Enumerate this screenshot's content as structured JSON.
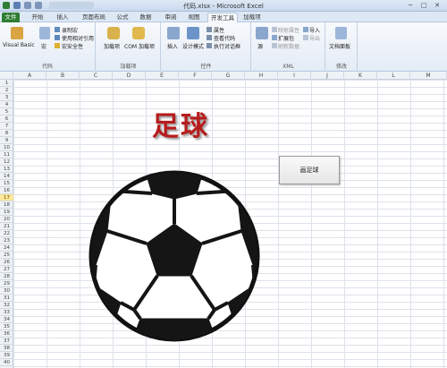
{
  "window": {
    "title": "代码.xlsx - Microsoft Excel",
    "minimize": "─",
    "restore": "□",
    "close": "✕"
  },
  "tabs": [
    "文件",
    "开始",
    "插入",
    "页面布局",
    "公式",
    "数据",
    "审阅",
    "视图",
    "开发工具",
    "加载项"
  ],
  "active_tab": "开发工具",
  "ribbon": {
    "code": {
      "label": "代码",
      "visual_basic": "Visual Basic",
      "macro": "宏",
      "record_macro": "录制宏",
      "relative_ref": "使用相对引用",
      "macro_security": "宏安全性"
    },
    "addins": {
      "label": "加载项",
      "addins": "加载项",
      "com_addins": "COM 加载项"
    },
    "controls": {
      "label": "控件",
      "insert": "插入",
      "design_mode": "设计模式",
      "properties": "属性",
      "view_code": "查看代码",
      "run_dialog": "执行对话框"
    },
    "xml": {
      "label": "XML",
      "source": "源",
      "map_props": "映射属性",
      "expansion_packs": "扩展包",
      "refresh_data": "刷新数据",
      "import": "导入",
      "export": "导出"
    },
    "modify": {
      "label": "修改",
      "document_panel": "文档面板"
    }
  },
  "columns": [
    "A",
    "B",
    "C",
    "D",
    "E",
    "F",
    "G",
    "H",
    "I",
    "J",
    "K",
    "L",
    "M"
  ],
  "rows": [
    "1",
    "2",
    "3",
    "4",
    "5",
    "6",
    "7",
    "8",
    "9",
    "10",
    "11",
    "12",
    "13",
    "14",
    "15",
    "16",
    "17",
    "18",
    "19",
    "20",
    "21",
    "22",
    "23",
    "24",
    "25",
    "26",
    "27",
    "28",
    "29",
    "30",
    "31",
    "32",
    "33",
    "34",
    "35",
    "36",
    "37",
    "38",
    "39",
    "40"
  ],
  "selected_row": "17",
  "sheet": {
    "title_word": "足球",
    "title_color": "#b71c1c",
    "draw_button": "画足球"
  }
}
